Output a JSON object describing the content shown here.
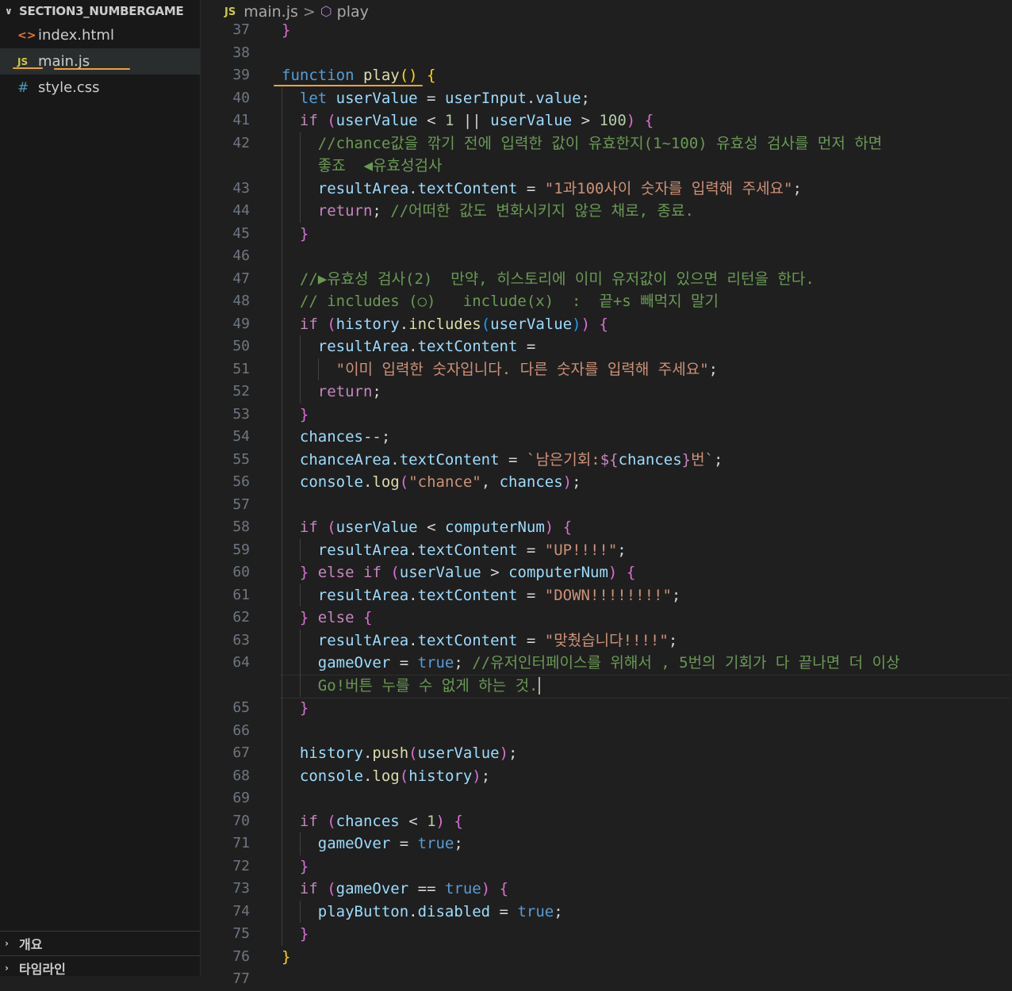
{
  "explorer": {
    "project_name": "SECTION3_NUMBERGAME",
    "files": [
      {
        "name": "index.html",
        "icon": "html-icon",
        "icon_glyph": "<>"
      },
      {
        "name": "main.js",
        "icon": "js-icon",
        "icon_glyph": "JS"
      },
      {
        "name": "style.css",
        "icon": "css-icon",
        "icon_glyph": "#"
      }
    ],
    "panels": [
      "개요",
      "타임라인"
    ]
  },
  "breadcrumb": {
    "file_badge": "JS",
    "file": "main.js",
    "separator": ">",
    "symbol": "play"
  },
  "colors": {
    "editor_bg": "#1f1f1f",
    "sidebar_bg": "#181818",
    "keyword": "#569cd6",
    "control": "#c586c0",
    "function": "#dcdcaa",
    "variable": "#9cdcfe",
    "string": "#ce9178",
    "number": "#b5cea8",
    "comment": "#6a9955",
    "annotation": "#e8a33d"
  },
  "code_lines": [
    {
      "n": "37",
      "indent": 0,
      "tokens": [
        [
          "b2",
          "}"
        ]
      ]
    },
    {
      "n": "38",
      "indent": 0,
      "tokens": []
    },
    {
      "n": "39",
      "indent": 0,
      "tokens": [
        [
          "k",
          "function"
        ],
        [
          "p",
          " "
        ],
        [
          "fn",
          "play"
        ],
        [
          "b1",
          "()"
        ],
        [
          "p",
          " "
        ],
        [
          "b1",
          "{"
        ]
      ]
    },
    {
      "n": "40",
      "indent": 1,
      "tokens": [
        [
          "k",
          "let"
        ],
        [
          "p",
          " "
        ],
        [
          "v",
          "userValue"
        ],
        [
          "p",
          " = "
        ],
        [
          "v",
          "userInput"
        ],
        [
          "p",
          "."
        ],
        [
          "v",
          "value"
        ],
        [
          "p",
          ";"
        ]
      ]
    },
    {
      "n": "41",
      "indent": 1,
      "tokens": [
        [
          "kc",
          "if"
        ],
        [
          "p",
          " "
        ],
        [
          "b2",
          "("
        ],
        [
          "v",
          "userValue"
        ],
        [
          "p",
          " < "
        ],
        [
          "n",
          "1"
        ],
        [
          "p",
          " || "
        ],
        [
          "v",
          "userValue"
        ],
        [
          "p",
          " > "
        ],
        [
          "n",
          "100"
        ],
        [
          "b2",
          ")"
        ],
        [
          "p",
          " "
        ],
        [
          "b2",
          "{"
        ]
      ]
    },
    {
      "n": "42",
      "indent": 2,
      "tokens": [
        [
          "c",
          "//chance값을 깎기 전에 입력한 값이 유효한지(1~100) 유효성 검사를 먼저 하면"
        ]
      ]
    },
    {
      "n": "",
      "indent": 2,
      "tokens": [
        [
          "c",
          "좋죠  ◀유효성검사"
        ]
      ]
    },
    {
      "n": "43",
      "indent": 2,
      "tokens": [
        [
          "v",
          "resultArea"
        ],
        [
          "p",
          "."
        ],
        [
          "v",
          "textContent"
        ],
        [
          "p",
          " = "
        ],
        [
          "s",
          "\"1과100사이 숫자를 입력해 주세요\""
        ],
        [
          "p",
          ";"
        ]
      ]
    },
    {
      "n": "44",
      "indent": 2,
      "tokens": [
        [
          "kc",
          "return"
        ],
        [
          "p",
          "; "
        ],
        [
          "c",
          "//어떠한 값도 변화시키지 않은 채로, 종료."
        ]
      ]
    },
    {
      "n": "45",
      "indent": 1,
      "tokens": [
        [
          "b2",
          "}"
        ]
      ]
    },
    {
      "n": "46",
      "indent": 1,
      "tokens": []
    },
    {
      "n": "47",
      "indent": 1,
      "tokens": [
        [
          "c",
          "//▶유효성 검사(2)  만약, 히스토리에 이미 유저값이 있으면 리턴을 한다."
        ]
      ]
    },
    {
      "n": "48",
      "indent": 1,
      "tokens": [
        [
          "c",
          "// includes (○)   include(x)  :  끝+s 빼먹지 말기"
        ]
      ]
    },
    {
      "n": "49",
      "indent": 1,
      "tokens": [
        [
          "kc",
          "if"
        ],
        [
          "p",
          " "
        ],
        [
          "b2",
          "("
        ],
        [
          "v",
          "history"
        ],
        [
          "p",
          "."
        ],
        [
          "fn",
          "includes"
        ],
        [
          "b3",
          "("
        ],
        [
          "v",
          "userValue"
        ],
        [
          "b3",
          ")"
        ],
        [
          "b2",
          ")"
        ],
        [
          "p",
          " "
        ],
        [
          "b2",
          "{"
        ]
      ]
    },
    {
      "n": "50",
      "indent": 2,
      "tokens": [
        [
          "v",
          "resultArea"
        ],
        [
          "p",
          "."
        ],
        [
          "v",
          "textContent"
        ],
        [
          "p",
          " ="
        ]
      ]
    },
    {
      "n": "51",
      "indent": 3,
      "tokens": [
        [
          "s",
          "\"이미 입력한 숫자입니다. 다른 숫자를 입력해 주세요\""
        ],
        [
          "p",
          ";"
        ]
      ]
    },
    {
      "n": "52",
      "indent": 2,
      "tokens": [
        [
          "kc",
          "return"
        ],
        [
          "p",
          ";"
        ]
      ]
    },
    {
      "n": "53",
      "indent": 1,
      "tokens": [
        [
          "b2",
          "}"
        ]
      ]
    },
    {
      "n": "54",
      "indent": 1,
      "tokens": [
        [
          "v",
          "chances"
        ],
        [
          "p",
          "--;"
        ]
      ]
    },
    {
      "n": "55",
      "indent": 1,
      "tokens": [
        [
          "v",
          "chanceArea"
        ],
        [
          "p",
          "."
        ],
        [
          "v",
          "textContent"
        ],
        [
          "p",
          " = "
        ],
        [
          "s",
          "`남은기회:"
        ],
        [
          "kc",
          "${"
        ],
        [
          "v",
          "chances"
        ],
        [
          "kc",
          "}"
        ],
        [
          "s",
          "번`"
        ],
        [
          "p",
          ";"
        ]
      ]
    },
    {
      "n": "56",
      "indent": 1,
      "tokens": [
        [
          "v",
          "console"
        ],
        [
          "p",
          "."
        ],
        [
          "fn",
          "log"
        ],
        [
          "b2",
          "("
        ],
        [
          "s",
          "\"chance\""
        ],
        [
          "p",
          ", "
        ],
        [
          "v",
          "chances"
        ],
        [
          "b2",
          ")"
        ],
        [
          "p",
          ";"
        ]
      ]
    },
    {
      "n": "57",
      "indent": 1,
      "tokens": []
    },
    {
      "n": "58",
      "indent": 1,
      "tokens": [
        [
          "kc",
          "if"
        ],
        [
          "p",
          " "
        ],
        [
          "b2",
          "("
        ],
        [
          "v",
          "userValue"
        ],
        [
          "p",
          " < "
        ],
        [
          "v",
          "computerNum"
        ],
        [
          "b2",
          ")"
        ],
        [
          "p",
          " "
        ],
        [
          "b2",
          "{"
        ]
      ]
    },
    {
      "n": "59",
      "indent": 2,
      "tokens": [
        [
          "v",
          "resultArea"
        ],
        [
          "p",
          "."
        ],
        [
          "v",
          "textContent"
        ],
        [
          "p",
          " = "
        ],
        [
          "s",
          "\"UP!!!!\""
        ],
        [
          "p",
          ";"
        ]
      ]
    },
    {
      "n": "60",
      "indent": 1,
      "tokens": [
        [
          "b2",
          "}"
        ],
        [
          "p",
          " "
        ],
        [
          "kc",
          "else"
        ],
        [
          "p",
          " "
        ],
        [
          "kc",
          "if"
        ],
        [
          "p",
          " "
        ],
        [
          "b2",
          "("
        ],
        [
          "v",
          "userValue"
        ],
        [
          "p",
          " > "
        ],
        [
          "v",
          "computerNum"
        ],
        [
          "b2",
          ")"
        ],
        [
          "p",
          " "
        ],
        [
          "b2",
          "{"
        ]
      ]
    },
    {
      "n": "61",
      "indent": 2,
      "tokens": [
        [
          "v",
          "resultArea"
        ],
        [
          "p",
          "."
        ],
        [
          "v",
          "textContent"
        ],
        [
          "p",
          " = "
        ],
        [
          "s",
          "\"DOWN!!!!!!!!\""
        ],
        [
          "p",
          ";"
        ]
      ]
    },
    {
      "n": "62",
      "indent": 1,
      "tokens": [
        [
          "b2",
          "}"
        ],
        [
          "p",
          " "
        ],
        [
          "kc",
          "else"
        ],
        [
          "p",
          " "
        ],
        [
          "b2",
          "{"
        ]
      ]
    },
    {
      "n": "63",
      "indent": 2,
      "tokens": [
        [
          "v",
          "resultArea"
        ],
        [
          "p",
          "."
        ],
        [
          "v",
          "textContent"
        ],
        [
          "p",
          " = "
        ],
        [
          "s",
          "\"맞췄습니다!!!!\""
        ],
        [
          "p",
          ";"
        ]
      ]
    },
    {
      "n": "64",
      "indent": 2,
      "tokens": [
        [
          "v",
          "gameOver"
        ],
        [
          "p",
          " = "
        ],
        [
          "k",
          "true"
        ],
        [
          "p",
          "; "
        ],
        [
          "c",
          "//유저인터페이스를 위해서 , 5번의 기회가 다 끝나면 더 이상"
        ]
      ]
    },
    {
      "n": "",
      "indent": 2,
      "tokens": [
        [
          "c",
          "Go!버튼 누를 수 없게 하는 것."
        ]
      ],
      "cursor": true
    },
    {
      "n": "65",
      "indent": 1,
      "tokens": [
        [
          "b2",
          "}"
        ]
      ]
    },
    {
      "n": "66",
      "indent": 1,
      "tokens": []
    },
    {
      "n": "67",
      "indent": 1,
      "tokens": [
        [
          "v",
          "history"
        ],
        [
          "p",
          "."
        ],
        [
          "fn",
          "push"
        ],
        [
          "b2",
          "("
        ],
        [
          "v",
          "userValue"
        ],
        [
          "b2",
          ")"
        ],
        [
          "p",
          ";"
        ]
      ]
    },
    {
      "n": "68",
      "indent": 1,
      "tokens": [
        [
          "v",
          "console"
        ],
        [
          "p",
          "."
        ],
        [
          "fn",
          "log"
        ],
        [
          "b2",
          "("
        ],
        [
          "v",
          "history"
        ],
        [
          "b2",
          ")"
        ],
        [
          "p",
          ";"
        ]
      ]
    },
    {
      "n": "69",
      "indent": 1,
      "tokens": []
    },
    {
      "n": "70",
      "indent": 1,
      "tokens": [
        [
          "kc",
          "if"
        ],
        [
          "p",
          " "
        ],
        [
          "b2",
          "("
        ],
        [
          "v",
          "chances"
        ],
        [
          "p",
          " < "
        ],
        [
          "n",
          "1"
        ],
        [
          "b2",
          ")"
        ],
        [
          "p",
          " "
        ],
        [
          "b2",
          "{"
        ]
      ]
    },
    {
      "n": "71",
      "indent": 2,
      "tokens": [
        [
          "v",
          "gameOver"
        ],
        [
          "p",
          " = "
        ],
        [
          "k",
          "true"
        ],
        [
          "p",
          ";"
        ]
      ]
    },
    {
      "n": "72",
      "indent": 1,
      "tokens": [
        [
          "b2",
          "}"
        ]
      ]
    },
    {
      "n": "73",
      "indent": 1,
      "tokens": [
        [
          "kc",
          "if"
        ],
        [
          "p",
          " "
        ],
        [
          "b2",
          "("
        ],
        [
          "v",
          "gameOver"
        ],
        [
          "p",
          " == "
        ],
        [
          "k",
          "true"
        ],
        [
          "b2",
          ")"
        ],
        [
          "p",
          " "
        ],
        [
          "b2",
          "{"
        ]
      ]
    },
    {
      "n": "74",
      "indent": 2,
      "tokens": [
        [
          "v",
          "playButton"
        ],
        [
          "p",
          "."
        ],
        [
          "v",
          "disabled"
        ],
        [
          "p",
          " = "
        ],
        [
          "k",
          "true"
        ],
        [
          "p",
          ";"
        ]
      ]
    },
    {
      "n": "75",
      "indent": 1,
      "tokens": [
        [
          "b2",
          "}"
        ]
      ]
    },
    {
      "n": "76",
      "indent": 0,
      "tokens": [
        [
          "b1",
          "}"
        ]
      ]
    },
    {
      "n": "77",
      "indent": 0,
      "tokens": []
    }
  ]
}
